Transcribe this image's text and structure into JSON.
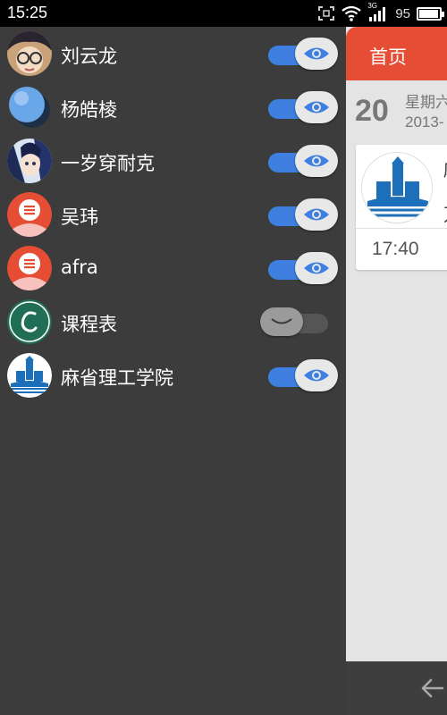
{
  "status_bar": {
    "time": "15:25",
    "network": "3G",
    "battery_percent": "95"
  },
  "drawer": {
    "items": [
      {
        "label": "刘云龙",
        "enabled": true
      },
      {
        "label": "杨皓棱",
        "enabled": true
      },
      {
        "label": "一岁穿耐克",
        "enabled": true
      },
      {
        "label": "吴玮",
        "enabled": true
      },
      {
        "label": "afra",
        "enabled": true
      },
      {
        "label": "课程表",
        "enabled": false
      },
      {
        "label": "麻省理工学院",
        "enabled": true
      }
    ]
  },
  "main": {
    "title": "首页",
    "date_day": "20",
    "weekday": "星期六",
    "year": "2013-",
    "card": {
      "line1": "麻",
      "line2": "万",
      "time": "17:40"
    }
  },
  "colors": {
    "accent_red": "#e64d35",
    "toggle_blue": "#3f7fe0",
    "drawer_bg": "#3c3c3c"
  }
}
